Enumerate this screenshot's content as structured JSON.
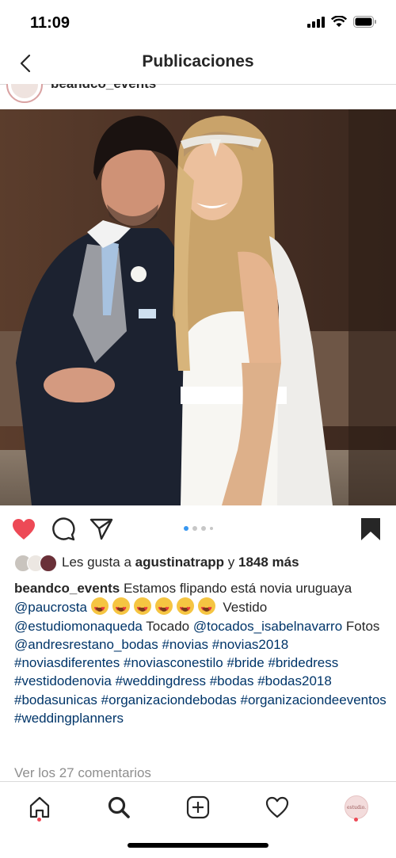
{
  "status_bar": {
    "time": "11:09"
  },
  "nav": {
    "title": "Publicaciones"
  },
  "post": {
    "username": "beandco_events",
    "carousel": {
      "total": 4,
      "active_index": 0
    },
    "likes": {
      "prefix": "Les gusta a",
      "user": "agustinatrapp",
      "connector": "y",
      "count": "1848 más"
    },
    "caption": {
      "username": "beandco_events",
      "text1": "Estamos flipando está novia uruguaya",
      "mention1": "@paucrosta",
      "emoji_count": 6,
      "text2": "Vestido",
      "mention2": "@estudiomonaqueda",
      "text3": "Tocado",
      "mention3": "@tocados_isabelnavarro",
      "text4": "Fotos",
      "mention4": "@andresrestano_bodas",
      "hashtags": [
        "#novias",
        "#novias2018",
        "#noviasdiferentes",
        "#noviasconestilo",
        "#bride",
        "#bridedress",
        "#vestidodenovia",
        "#weddingdress",
        "#bodas",
        "#bodas2018",
        "#bodasunicas",
        "#organizaciondebodas",
        "#organizaciondeeventos",
        "#weddingplanners"
      ]
    },
    "comments_link": "Ver los 27 comentarios"
  },
  "tab_bar": {
    "profile_label": "estudio."
  },
  "colors": {
    "like_red": "#ed4956",
    "link_blue": "#003569",
    "carousel_active": "#3897f0"
  }
}
